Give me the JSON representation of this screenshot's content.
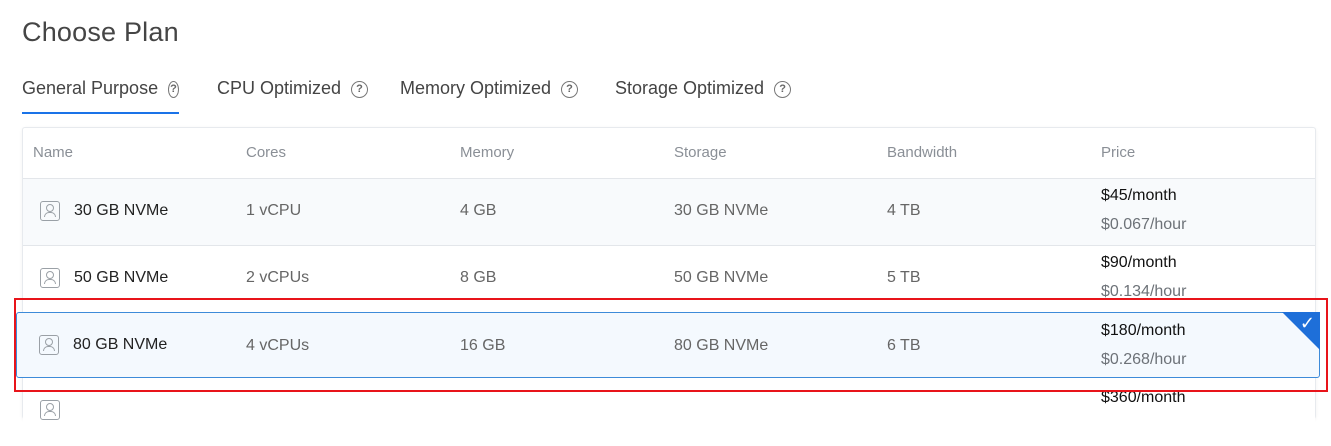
{
  "page": {
    "title": "Choose Plan"
  },
  "tabs": [
    {
      "label": "General Purpose",
      "active": true
    },
    {
      "label": "CPU Optimized",
      "active": false
    },
    {
      "label": "Memory Optimized",
      "active": false
    },
    {
      "label": "Storage Optimized",
      "active": false
    }
  ],
  "help_icon_glyph": "?",
  "table": {
    "headers": [
      "Name",
      "Cores",
      "Memory",
      "Storage",
      "Bandwidth",
      "Price"
    ],
    "rows": [
      {
        "name": "30 GB NVMe",
        "cores": "1 vCPU",
        "memory": "4 GB",
        "storage": "30 GB NVMe",
        "bandwidth": "4 TB",
        "price_month": "$45/month",
        "price_hour": "$0.067/hour",
        "selected": false
      },
      {
        "name": "50 GB NVMe",
        "cores": "2 vCPUs",
        "memory": "8 GB",
        "storage": "50 GB NVMe",
        "bandwidth": "5 TB",
        "price_month": "$90/month",
        "price_hour": "$0.134/hour",
        "selected": false
      },
      {
        "name": "80 GB NVMe",
        "cores": "4 vCPUs",
        "memory": "16 GB",
        "storage": "80 GB NVMe",
        "bandwidth": "6 TB",
        "price_month": "$180/month",
        "price_hour": "$0.268/hour",
        "selected": true
      },
      {
        "price_month": "$360/month"
      }
    ]
  },
  "icons": {
    "row_icon": "cpu-chip-icon",
    "help_icon": "help-circle-icon",
    "selected_icon": "checkmark-icon"
  },
  "colors": {
    "accent": "#1a73e8",
    "selected_border": "#3d8bd9",
    "selected_corner": "#1e6fd9",
    "highlight_annotation": "#e8141a"
  }
}
